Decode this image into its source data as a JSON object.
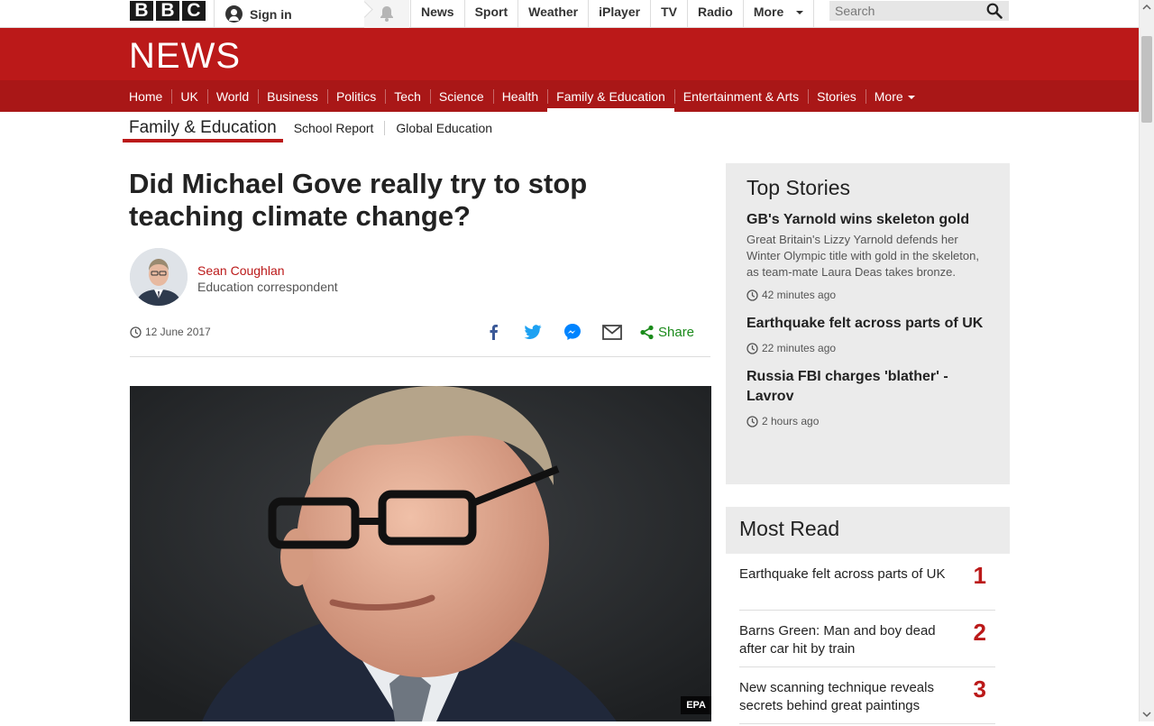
{
  "global_bar": {
    "logo_letters": [
      "B",
      "B",
      "C"
    ],
    "sign_in": "Sign in",
    "nav": [
      "News",
      "Sport",
      "Weather",
      "iPlayer",
      "TV",
      "Radio",
      "More"
    ],
    "search_placeholder": "Search"
  },
  "banner": {
    "title": "NEWS"
  },
  "news_nav": {
    "items": [
      "Home",
      "UK",
      "World",
      "Business",
      "Politics",
      "Tech",
      "Science",
      "Health",
      "Family & Education",
      "Entertainment & Arts",
      "Stories",
      "More"
    ],
    "active": "Family & Education"
  },
  "section_nav": {
    "title": "Family & Education",
    "links": [
      "School Report",
      "Global Education"
    ]
  },
  "article": {
    "headline": "Did Michael Gove really try to stop teaching climate change?",
    "author": "Sean Coughlan",
    "author_role": "Education correspondent",
    "date": "12 June 2017",
    "share_label": "Share",
    "image_credit": "EPA"
  },
  "top_stories": {
    "title": "Top Stories",
    "items": [
      {
        "headline": "GB's Yarnold wins skeleton gold",
        "summary": "Great Britain's Lizzy Yarnold defends her Winter Olympic title with gold in the skeleton, as team-mate Laura Deas takes bronze.",
        "time": "42 minutes ago"
      },
      {
        "headline": "Earthquake felt across parts of UK",
        "summary": "",
        "time": "22 minutes ago"
      },
      {
        "headline": "Russia FBI charges 'blather' - Lavrov",
        "summary": "",
        "time": "2 hours ago"
      }
    ]
  },
  "most_read": {
    "title": "Most Read",
    "items": [
      {
        "text": "Earthquake felt across parts of UK",
        "rank": "1"
      },
      {
        "text": "Barns Green: Man and boy dead after car hit by train",
        "rank": "2"
      },
      {
        "text": "New scanning technique reveals secrets behind great paintings",
        "rank": "3"
      }
    ]
  },
  "colors": {
    "brand_red": "#bb1919",
    "nav_red": "#a91717",
    "share_green": "#1a8a1a"
  }
}
